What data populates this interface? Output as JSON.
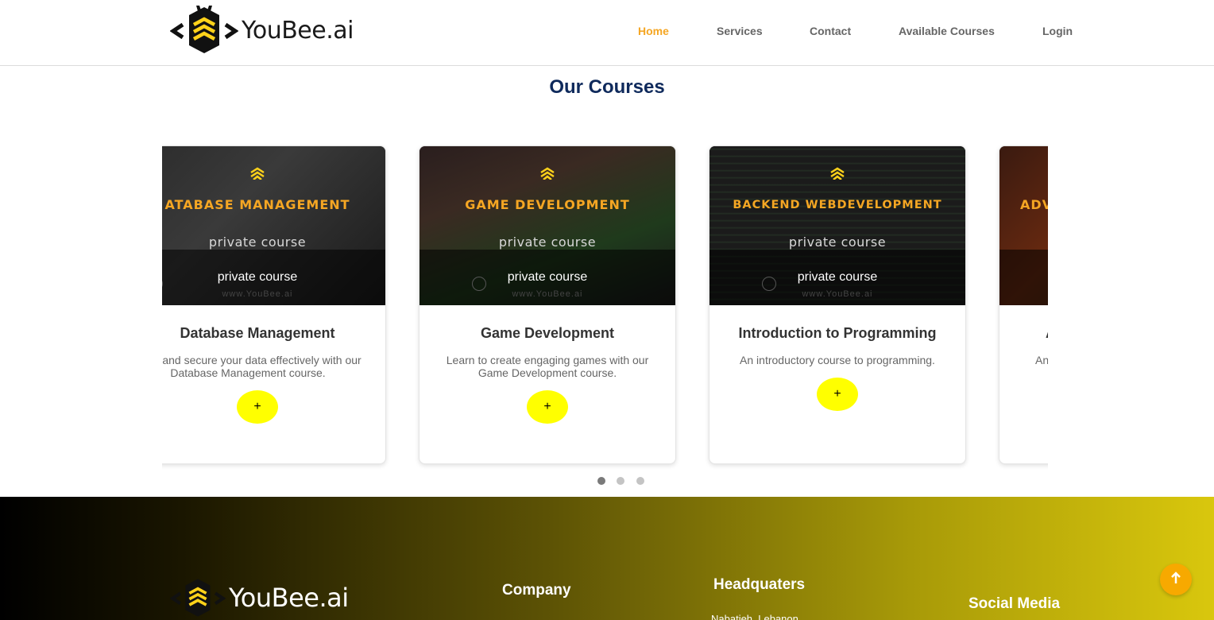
{
  "header": {
    "logo_text": "YouBee.ai",
    "nav": [
      {
        "label": "Home",
        "active": true
      },
      {
        "label": "Services",
        "active": false
      },
      {
        "label": "Contact",
        "active": false
      },
      {
        "label": "Available Courses",
        "active": false
      },
      {
        "label": "Login",
        "active": false
      }
    ]
  },
  "courses_section": {
    "title": "Our Courses",
    "cards": [
      {
        "image_title": "ATABASE MANAGEMENT",
        "image_subtitle": "private course",
        "overlay_text": "private course",
        "watermark": "www.YouBee.ai",
        "title": "Database Management",
        "description": "nage and secure your data effectively with our Database Management course.",
        "button_label": "+"
      },
      {
        "image_title": "GAME DEVELOPMENT",
        "image_subtitle": "private course",
        "overlay_text": "private course",
        "watermark": "www.YouBee.ai",
        "title": "Game Development",
        "description": "Learn to create engaging games with our Game Development course.",
        "button_label": "+"
      },
      {
        "image_title": "BACKEND WEBDEVELOPMENT",
        "image_subtitle": "private course",
        "overlay_text": "private course",
        "watermark": "www.YouBee.ai",
        "title": "Introduction to Programming",
        "description": "An introductory course to programming.",
        "button_label": "+"
      },
      {
        "image_title": "ADV",
        "image_subtitle": "",
        "overlay_text": "",
        "watermark": "",
        "title": "A",
        "description": "An",
        "button_label": ""
      }
    ],
    "pagination": {
      "count": 3,
      "active_index": 0
    }
  },
  "footer": {
    "logo_text": "YouBee.ai",
    "company_heading": "Company",
    "headquarters_heading": "Headquaters",
    "headquarters_address": "Nabatieh, Lebanon",
    "social_heading": "Social Media"
  },
  "scroll_top_icon": "arrow-up-icon",
  "colors": {
    "accent_orange": "#f5a623",
    "title_navy": "#0f2a5c",
    "button_yellow": "#ffff00",
    "scroll_button": "#f7a900"
  }
}
